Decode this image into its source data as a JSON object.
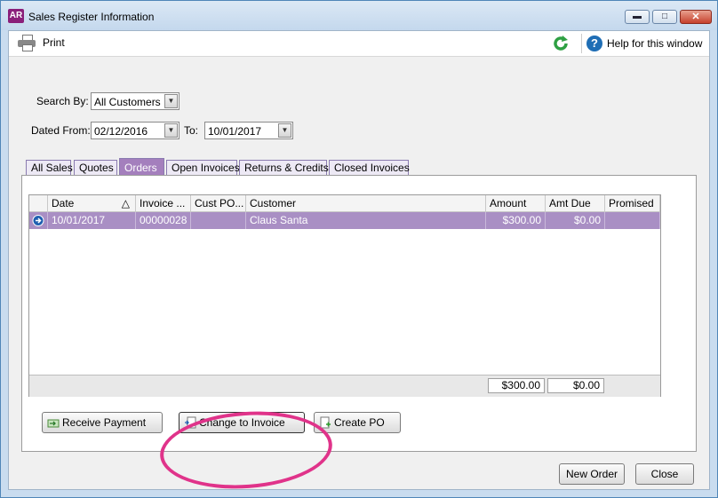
{
  "window": {
    "app_icon_text": "AR",
    "title": "Sales Register Information",
    "minimize_glyph": "▬",
    "maximize_glyph": "□",
    "close_glyph": "✕"
  },
  "toolbar": {
    "print_label": "Print",
    "help_label": "Help for this window",
    "help_glyph": "?"
  },
  "filters": {
    "search_by_label": "Search By:",
    "search_by_value": "All Customers",
    "dated_from_label": "Dated From:",
    "dated_from_value": "02/12/2016",
    "to_label": "To:",
    "to_value": "10/01/2017",
    "dropdown_glyph": "▼"
  },
  "tabs": [
    {
      "label": "All Sales"
    },
    {
      "label": "Quotes"
    },
    {
      "label": "Orders"
    },
    {
      "label": "Open Invoices"
    },
    {
      "label": "Returns & Credits"
    },
    {
      "label": "Closed Invoices"
    }
  ],
  "active_tab": "Orders",
  "table": {
    "sort_glyph": "△",
    "columns": [
      "Date",
      "Invoice ...",
      "Cust PO...",
      "Customer",
      "Amount",
      "Amt Due",
      "Promised"
    ],
    "rows": [
      {
        "date": "10/01/2017",
        "invoice": "00000028",
        "cust_po": "",
        "customer": "Claus Santa",
        "amount": "$300.00",
        "amt_due": "$0.00",
        "promised": ""
      }
    ],
    "totals": {
      "amount": "$300.00",
      "amt_due": "$0.00"
    }
  },
  "buttons": {
    "receive_payment": "Receive Payment",
    "change_to_invoice": "Change to Invoice",
    "create_po": "Create PO",
    "new_order": "New Order",
    "close": "Close"
  },
  "colors": {
    "selected_row": "#a98fc4",
    "active_tab": "#a47fbd",
    "annotation_circle": "#e0338a"
  }
}
